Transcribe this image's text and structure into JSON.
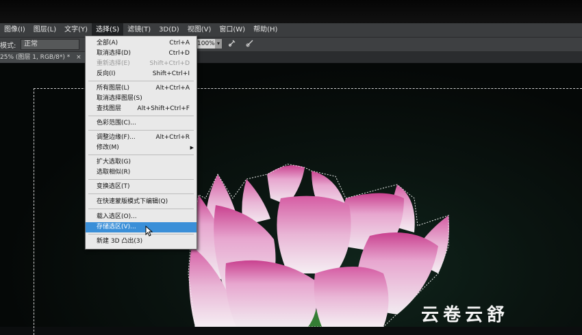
{
  "menubar": {
    "items": [
      "图像(I)",
      "图层(L)",
      "文字(Y)",
      "选择(S)",
      "滤镜(T)",
      "3D(D)",
      "视图(V)",
      "窗口(W)",
      "帮助(H)"
    ],
    "active_index": 3
  },
  "options": {
    "mode_label": "模式:",
    "mode_value": "正常",
    "zoom_value": "100%",
    "zoom_arrow": "▾"
  },
  "document_tab": {
    "title": "25% (图层 1, RGB/8*) *",
    "close": "×"
  },
  "select_menu": {
    "items": [
      {
        "label": "全部(A)",
        "shortcut": "Ctrl+A",
        "disabled": false
      },
      {
        "label": "取消选择(D)",
        "shortcut": "Ctrl+D",
        "disabled": false
      },
      {
        "label": "重新选择(E)",
        "shortcut": "Shift+Ctrl+D",
        "disabled": true
      },
      {
        "label": "反向(I)",
        "shortcut": "Shift+Ctrl+I",
        "disabled": false
      },
      {
        "label": "所有图层(L)",
        "shortcut": "Alt+Ctrl+A",
        "disabled": false
      },
      {
        "label": "取消选择图层(S)",
        "shortcut": "",
        "disabled": false
      },
      {
        "label": "查找图层",
        "shortcut": "Alt+Shift+Ctrl+F",
        "disabled": false
      },
      {
        "label": "色彩范围(C)...",
        "shortcut": "",
        "disabled": false
      },
      {
        "label": "调整边缘(F)...",
        "shortcut": "Alt+Ctrl+R",
        "disabled": false
      },
      {
        "label": "修改(M)",
        "shortcut": "",
        "disabled": false,
        "submenu": true
      },
      {
        "label": "扩大选取(G)",
        "shortcut": "",
        "disabled": false
      },
      {
        "label": "选取相似(R)",
        "shortcut": "",
        "disabled": false
      },
      {
        "label": "变换选区(T)",
        "shortcut": "",
        "disabled": false
      },
      {
        "label": "在快速蒙版模式下编辑(Q)",
        "shortcut": "",
        "disabled": false
      },
      {
        "label": "载入选区(O)...",
        "shortcut": "",
        "disabled": false
      },
      {
        "label": "存储选区(V)...",
        "shortcut": "",
        "disabled": false,
        "highlighted": true
      },
      {
        "label": "新建 3D 凸出(3)",
        "shortcut": "",
        "disabled": false
      }
    ],
    "submenu_arrow": "▶"
  },
  "watermark": "云卷云舒",
  "colors": {
    "menubar_bg": "#3b3d3f",
    "highlight": "#3a8fd8",
    "lotus_pink": "#e7a6cf"
  }
}
